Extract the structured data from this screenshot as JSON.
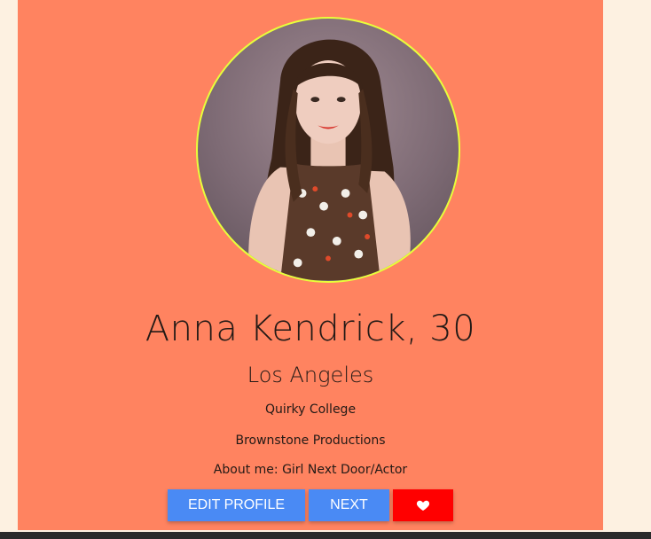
{
  "profile": {
    "name_age": "Anna Kendrick, 30",
    "city": "Los Angeles",
    "college": "Quirky College",
    "company": "Brownstone Productions",
    "about_label": "About me:",
    "about_text": "Girl Next Door/Actor"
  },
  "actions": {
    "edit_label": "EDIT PROFILE",
    "next_label": "NEXT",
    "like_icon": "heart-icon"
  },
  "colors": {
    "page_background": "#fdf1e1",
    "card_background": "#ff8360",
    "primary_button": "#4a8af4",
    "like_button": "#ff0000",
    "avatar_border": "#e8ff3a"
  }
}
